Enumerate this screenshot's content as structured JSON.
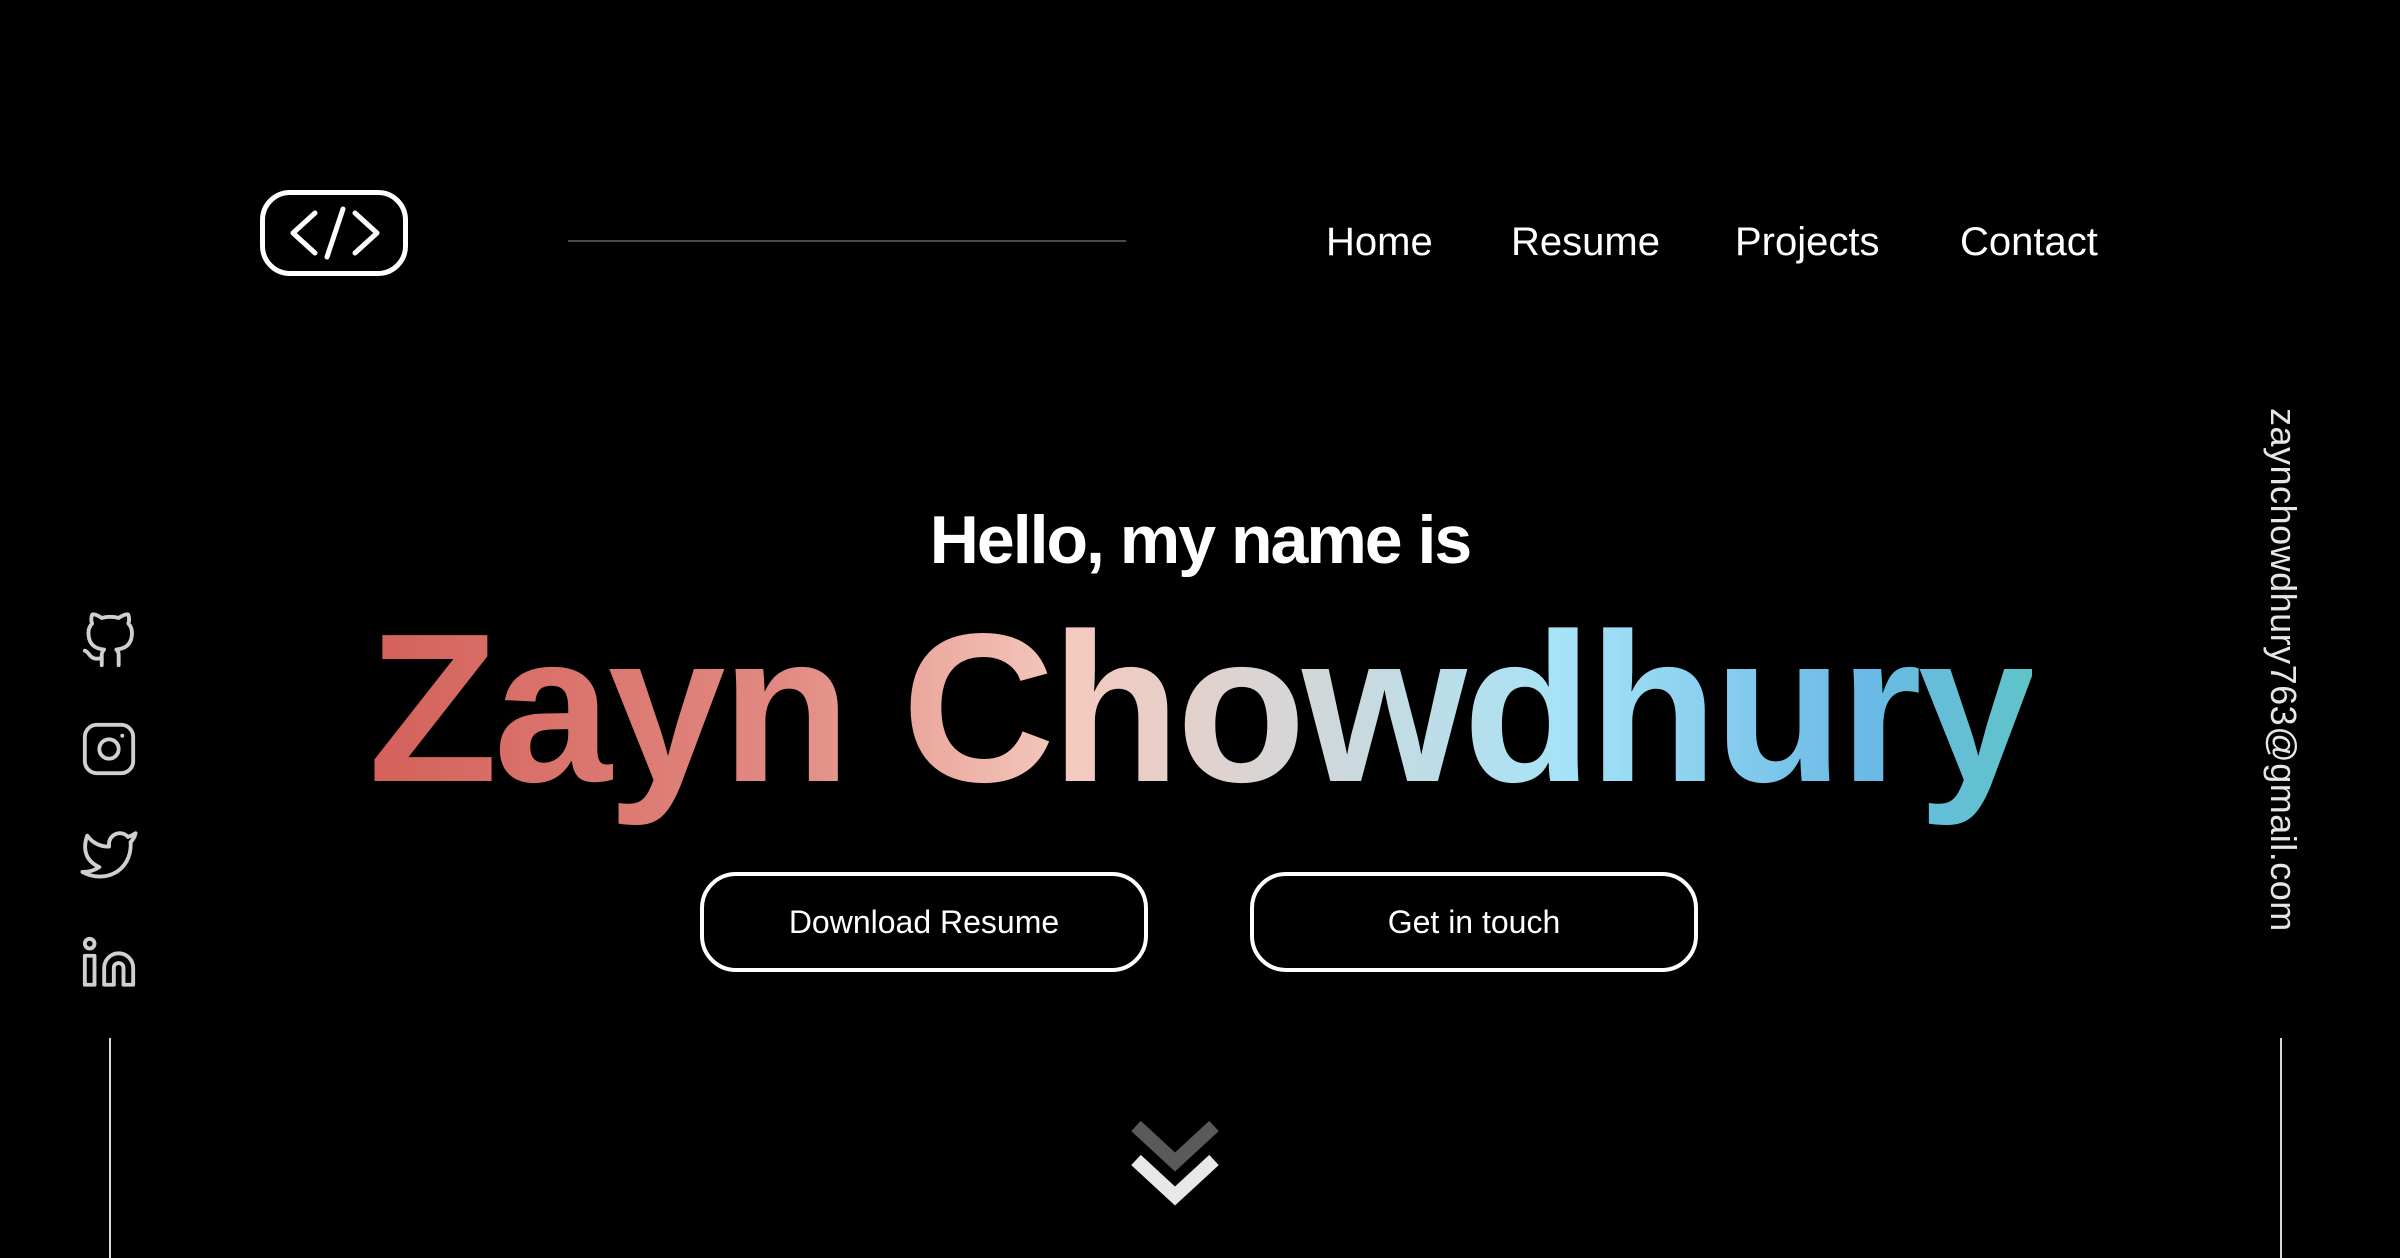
{
  "app": {
    "logo_icon": "code-brackets-icon"
  },
  "nav": {
    "items": [
      {
        "label": "Home"
      },
      {
        "label": "Resume"
      },
      {
        "label": "Projects"
      },
      {
        "label": "Contact"
      }
    ]
  },
  "social": {
    "icons": [
      "github-icon",
      "instagram-icon",
      "twitter-icon",
      "linkedin-icon"
    ]
  },
  "hero": {
    "greeting": "Hello, my name is",
    "name": "Zayn Chowdhury",
    "gradient_colors": [
      "#d4605a",
      "#e18a82",
      "#f4c9bd",
      "#d6d6d6",
      "#a6e3f7",
      "#6ab9e6",
      "#5fc4c8"
    ]
  },
  "buttons": {
    "download_label": "Download Resume",
    "contact_label": "Get in touch"
  },
  "contact": {
    "email": "zaynchowdhury763@gmail.com"
  },
  "scroll": {
    "icon": "double-chevron-down-icon"
  },
  "colors": {
    "background": "#000000",
    "text": "#ffffff",
    "rule": "#4a4a4a"
  }
}
